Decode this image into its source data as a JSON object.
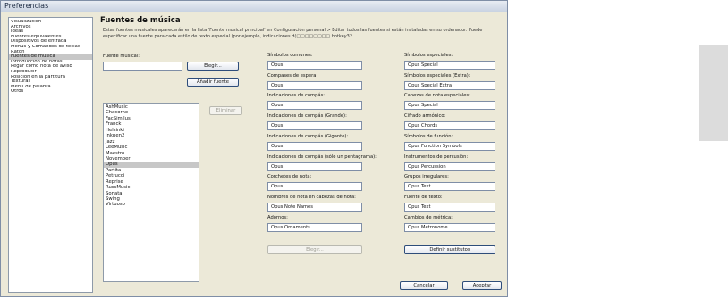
{
  "window": {
    "title": "Preferencias"
  },
  "sidebar": {
    "items": [
      {
        "label": "Visualización"
      },
      {
        "label": "Archivos"
      },
      {
        "label": "Ideas"
      },
      {
        "label": "Fuentes equivalentes"
      },
      {
        "label": "Dispositivos de entrada"
      },
      {
        "label": "Menús y Comandos de teclad"
      },
      {
        "label": "Ratón"
      },
      {
        "label": "Fuentes de música",
        "selected": true
      },
      {
        "label": "Introducción de notas"
      },
      {
        "label": "Pegar como nota de aviso"
      },
      {
        "label": "Reproducir"
      },
      {
        "label": "Posición en la partitura"
      },
      {
        "label": "Texturas"
      },
      {
        "label": "Menú de palabra"
      },
      {
        "label": "Otros"
      }
    ]
  },
  "content": {
    "title": "Fuentes de música",
    "description": "Estas fuentes musicales aparecerán en la lista 'Fuente musical principal' en Configuración personal > Editar todos las fuentes si están instaladas en su ordenador. Puede especificar una fuente para cada estilo de texto especial (por ejemplo, indicaciones d(□□□□□□□□ hotkey32",
    "music_font_label": "Fuente musical:",
    "music_font_value": "",
    "choose_button": "Elegir...",
    "add_font_button": "Añadir fuente",
    "remove_button": "Eliminar",
    "font_list": [
      {
        "name": "AshMusic"
      },
      {
        "name": "Chacorne"
      },
      {
        "name": "FacSimilus"
      },
      {
        "name": "Franck"
      },
      {
        "name": "Helsinki"
      },
      {
        "name": "Inkpen2"
      },
      {
        "name": "Jazz"
      },
      {
        "name": "LeeMusic"
      },
      {
        "name": "Maestro"
      },
      {
        "name": "November"
      },
      {
        "name": "Opus",
        "selected": true
      },
      {
        "name": "Partita"
      },
      {
        "name": "Petrucci"
      },
      {
        "name": "Reprise"
      },
      {
        "name": "RussMusic"
      },
      {
        "name": "Sonata"
      },
      {
        "name": "Swing"
      },
      {
        "name": "Virtuoso"
      }
    ],
    "middle_fields": [
      {
        "label": "Símbolos comunes:",
        "value": "Opus"
      },
      {
        "label": "Compases de espera:",
        "value": "Opus"
      },
      {
        "label": "Indicaciones de compás:",
        "value": "Opus"
      },
      {
        "label": "Indicaciones de compás (Grande):",
        "value": "Opus"
      },
      {
        "label": "Indicaciones de compás (Gigante):",
        "value": "Opus"
      },
      {
        "label": "Indicaciones de compás (sólo un pentagrama):",
        "value": "Opus"
      },
      {
        "label": "Corchetes de nota:",
        "value": "Opus"
      },
      {
        "label": "Nombres de nota en cabezas de nota:",
        "value": "Opus Note Names"
      },
      {
        "label": "Adornos:",
        "value": "Opus Ornaments"
      }
    ],
    "middle_button": "Elegir...",
    "right_fields": [
      {
        "label": "Símbolos especiales:",
        "value": "Opus Special"
      },
      {
        "label": "Símbolos especiales (Extra):",
        "value": "Opus Special Extra"
      },
      {
        "label": "Cabezas de nota especiales:",
        "value": "Opus Special"
      },
      {
        "label": "Cifrado armónico:",
        "value": "Opus Chords"
      },
      {
        "label": "Símbolos de función:",
        "value": "Opus Function Symbols"
      },
      {
        "label": "Instrumentos de percusión:",
        "value": "Opus Percussion"
      },
      {
        "label": "Grupos irregulares:",
        "value": "Opus Text"
      },
      {
        "label": "Fuente de texto:",
        "value": "Opus Text"
      },
      {
        "label": "Cambios de métrica:",
        "value": "Opus Metronome"
      }
    ],
    "define_substitutes_button": "Definir sustitutos"
  },
  "footer": {
    "cancel_label": "Cancelar",
    "accept_label": "Aceptar"
  },
  "colors": {
    "dialog_bg": "#ece9d8",
    "selection": "#c7c7c7",
    "button_border": "#2e4d7a",
    "title_bar": "#c9d3e2"
  }
}
